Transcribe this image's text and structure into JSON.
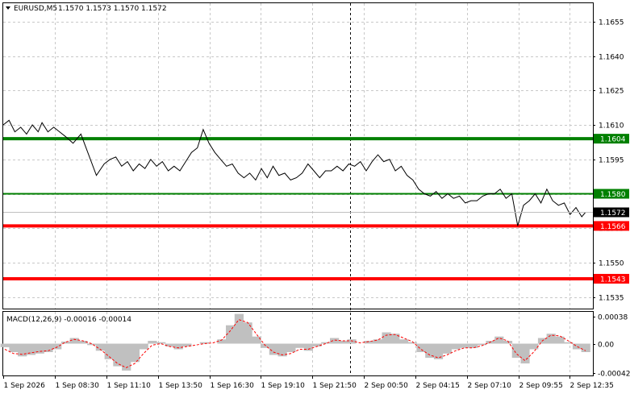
{
  "title": {
    "symbol": "EURUSD,M5",
    "ohlc": "1.1570 1.1573 1.1570 1.1572"
  },
  "indicator": {
    "label": "MACD(12,26,9) -0.00016 -0.00014",
    "y_ticks": [
      "0.00038",
      "0.00",
      "-0.00042"
    ]
  },
  "chart_data": {
    "type": "line",
    "symbol": "EURUSD",
    "timeframe": "M5",
    "ylim": [
      1.153,
      1.1663
    ],
    "y_ticks": [
      "1.1655",
      "1.1640",
      "1.1625",
      "1.1610",
      "1.1595",
      "1.1580",
      "1.1565",
      "1.1550",
      "1.1535"
    ],
    "x_ticks": [
      "1 Sep 2026",
      "1 Sep 08:30",
      "1 Sep 11:10",
      "1 Sep 13:50",
      "1 Sep 16:30",
      "1 Sep 19:10",
      "1 Sep 21:50",
      "2 Sep 00:50",
      "2 Sep 04:15",
      "2 Sep 07:10",
      "2 Sep 09:55",
      "2 Sep 12:35"
    ],
    "current_price": "1.1572",
    "levels": [
      {
        "label": "1.1604",
        "value": 1.1604,
        "color": "#008000"
      },
      {
        "label": "1.1580",
        "value": 1.158,
        "color": "#008000"
      },
      {
        "label": "1.1566",
        "value": 1.1566,
        "color": "#ff0000"
      },
      {
        "label": "1.1543",
        "value": 1.1543,
        "color": "#ff0000"
      }
    ],
    "series": [
      {
        "x_index": [
          0,
          3,
          6,
          9,
          12,
          15,
          18,
          20,
          23,
          26,
          29,
          32,
          36,
          40,
          44,
          48,
          52,
          55,
          58,
          61,
          64,
          67,
          70,
          73,
          76,
          79,
          82,
          85,
          88,
          91,
          94,
          97,
          100,
          103,
          106,
          109,
          112,
          115,
          118,
          121,
          124,
          127,
          130,
          133,
          136,
          139,
          142,
          145,
          148,
          151,
          154,
          157,
          160,
          163,
          166,
          169,
          172,
          175,
          178,
          181,
          184,
          187,
          190,
          193,
          196,
          199,
          202,
          205,
          208,
          211,
          214,
          217,
          220,
          223,
          226,
          229,
          232,
          235,
          238,
          241,
          244,
          247,
          250,
          253,
          256,
          259,
          262,
          265,
          268,
          271,
          274,
          277,
          280,
          283,
          286,
          289,
          292,
          295,
          298,
          300
        ],
        "values": [
          1.161,
          1.1612,
          1.1607,
          1.1609,
          1.1606,
          1.161,
          1.1607,
          1.1611,
          1.1607,
          1.1609,
          1.1607,
          1.1605,
          1.1602,
          1.1606,
          1.1597,
          1.1588,
          1.1593,
          1.1595,
          1.1596,
          1.1592,
          1.1594,
          1.159,
          1.1593,
          1.1591,
          1.1595,
          1.1592,
          1.1594,
          1.159,
          1.1592,
          1.159,
          1.1594,
          1.1598,
          1.16,
          1.1608,
          1.1602,
          1.1598,
          1.1595,
          1.1592,
          1.1593,
          1.1589,
          1.1587,
          1.1589,
          1.1586,
          1.1591,
          1.1587,
          1.1592,
          1.1588,
          1.1589,
          1.1586,
          1.1587,
          1.1589,
          1.1593,
          1.159,
          1.1587,
          1.159,
          1.159,
          1.1592,
          1.159,
          1.1593,
          1.1592,
          1.1594,
          1.159,
          1.1594,
          1.1597,
          1.1594,
          1.1595,
          1.159,
          1.1592,
          1.1588,
          1.1586,
          1.1582,
          1.158,
          1.1579,
          1.1581,
          1.1578,
          1.158,
          1.1578,
          1.1579,
          1.1576,
          1.1577,
          1.1577,
          1.1579,
          1.158,
          1.158,
          1.1582,
          1.1578,
          1.158,
          1.1566,
          1.1575,
          1.1577,
          1.158,
          1.1576,
          1.1582,
          1.1577,
          1.1575,
          1.1576,
          1.1571,
          1.1574,
          1.157,
          1.1572
        ]
      }
    ]
  },
  "colors": {
    "price_line": "#000000",
    "grid": "#c8c8c8",
    "level_green": "#008000",
    "level_red": "#ff0000",
    "current_badge": "#000000",
    "histogram": "#c0c0c0",
    "signal": "#ff0000"
  },
  "macd_data": {
    "ylim": [
      -0.00045,
      0.00045
    ],
    "histogram": [
      -5e-05,
      -0.00012,
      -0.00018,
      -0.00016,
      -0.00014,
      -0.00012,
      -8e-05,
      3e-05,
      8e-05,
      4e-05,
      -2e-05,
      -0.0001,
      -0.00022,
      -0.00032,
      -0.00038,
      -0.00026,
      -8e-05,
      4e-05,
      2e-05,
      -4e-05,
      -8e-05,
      -4e-05,
      0.0,
      2e-05,
      0.0,
      6e-05,
      0.00026,
      0.00042,
      0.0003,
      0.0001,
      -6e-05,
      -0.00016,
      -0.00018,
      -0.00012,
      -6e-05,
      -0.0001,
      -4e-05,
      2e-05,
      8e-05,
      4e-05,
      6e-05,
      0.0,
      4e-05,
      6e-05,
      0.00016,
      0.00014,
      6e-05,
      2e-05,
      -0.00012,
      -0.0002,
      -0.00022,
      -0.00014,
      -8e-05,
      -6e-05,
      -6e-05,
      -2e-05,
      4e-05,
      0.0001,
      4e-05,
      -0.0002,
      -0.00028,
      -8e-05,
      8e-05,
      0.00014,
      0.0001,
      2e-05,
      -8e-05,
      -0.00012
    ],
    "signal": [
      -8e-05,
      -0.00014,
      -0.00015,
      -0.00013,
      -0.00011,
      -0.0001,
      -5e-05,
      2e-05,
      6e-05,
      4e-05,
      0.0,
      -8e-05,
      -0.00018,
      -0.00028,
      -0.00034,
      -0.00028,
      -0.00014,
      -2e-05,
      0.0,
      -4e-05,
      -6e-05,
      -4e-05,
      -2e-05,
      0.0,
      1e-05,
      5e-05,
      0.00018,
      0.00034,
      0.0003,
      0.00014,
      -2e-05,
      -0.00012,
      -0.00016,
      -0.00014,
      -8e-05,
      -8e-05,
      -4e-05,
      0.0,
      5e-05,
      4e-05,
      4e-05,
      1e-05,
      3e-05,
      5e-05,
      0.00012,
      0.00013,
      8e-05,
      3e-05,
      -8e-05,
      -0.00016,
      -0.0002,
      -0.00016,
      -0.0001,
      -6e-05,
      -6e-05,
      -3e-05,
      2e-05,
      8e-05,
      4e-05,
      -0.00014,
      -0.00024,
      -0.00012,
      4e-05,
      0.00012,
      0.00011,
      4e-05,
      -4e-05,
      -0.0001
    ]
  }
}
